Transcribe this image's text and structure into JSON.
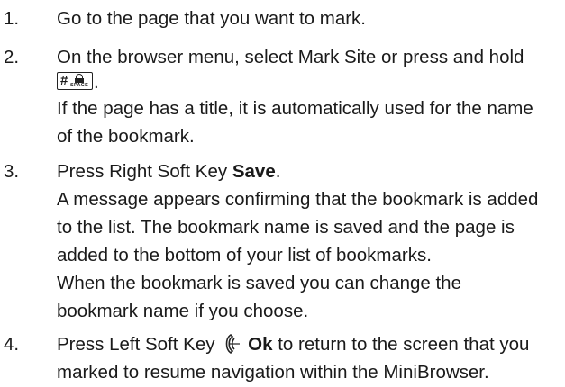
{
  "steps": [
    {
      "number": "1.",
      "line1": "Go to the page that you want to mark."
    },
    {
      "number": "2.",
      "line1": "On the browser menu, select Mark Site or press and hold",
      "key_icon": {
        "name": "hash-space-key-icon",
        "hash": "#",
        "space": "SPACE"
      },
      "key_suffix": ".",
      "line3": "If the page has a title, it is automatically used for the name",
      "line4": "of the bookmark."
    },
    {
      "number": "3.",
      "line1_prefix": "Press Right Soft Key ",
      "line1_bold": "Save",
      "line1_suffix": ".",
      "line2": "A message appears confirming that the bookmark is added",
      "line3": "to the list. The bookmark name is saved and the page is",
      "line4": "added to the bottom of your list of bookmarks.",
      "line5": "When the bookmark is saved you can change the",
      "line6": "bookmark name if you choose."
    },
    {
      "number": "4.",
      "line1_prefix": "Press Left Soft Key ",
      "soft_key_icon": "left-soft-key-icon",
      "line1_bold": "Ok",
      "line1_suffix": " to return to the screen that you",
      "line2": "marked to resume navigation within the MiniBrowser."
    }
  ]
}
